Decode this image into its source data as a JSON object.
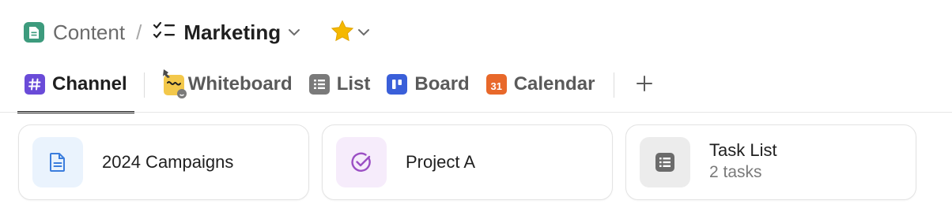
{
  "breadcrumb": {
    "space_icon": "document-icon",
    "space_color": "#3d9b7d",
    "space_name": "Content",
    "separator": "/",
    "current_icon": "checklist-icon",
    "current_name": "Marketing",
    "favorite_icon": "star-icon",
    "favorite_color": "#f5b800"
  },
  "tabs": [
    {
      "label": "Channel",
      "icon": "hash-icon",
      "color": "#6a4bd8",
      "active": true
    },
    {
      "label": "Whiteboard",
      "icon": "whiteboard-icon",
      "color": "#f3c84b",
      "active": false
    },
    {
      "label": "List",
      "icon": "list-icon",
      "color": "#7a7a7a",
      "active": false
    },
    {
      "label": "Board",
      "icon": "board-icon",
      "color": "#3a5fd9",
      "active": false
    },
    {
      "label": "Calendar",
      "icon": "calendar-icon",
      "color": "#e8682a",
      "calendar_day": "31",
      "active": false
    }
  ],
  "add_view_icon": "plus-icon",
  "cards": [
    {
      "title": "2024 Campaigns",
      "subtitle": "",
      "icon": "document-icon",
      "icon_bg": "#eaf3fd",
      "icon_color": "#3b7ddd"
    },
    {
      "title": "Project A",
      "subtitle": "",
      "icon": "check-circle-icon",
      "icon_bg": "#f6ecfb",
      "icon_color": "#9b4fc4"
    },
    {
      "title": "Task List",
      "subtitle": "2 tasks",
      "icon": "list-icon",
      "icon_bg": "#ececec",
      "icon_color": "#6b6b6b"
    }
  ]
}
